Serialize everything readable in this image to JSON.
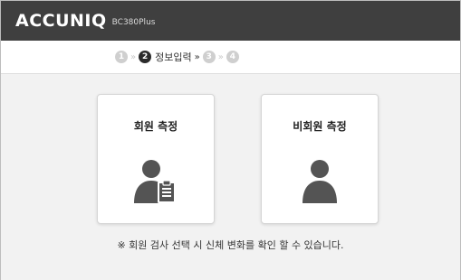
{
  "header": {
    "brand": "ACCUNIQ",
    "model": "BC380Plus"
  },
  "steps": {
    "items": [
      {
        "number": "1",
        "active": false
      },
      {
        "number": "2",
        "active": true,
        "label": "정보입력"
      },
      {
        "number": "3",
        "active": false
      },
      {
        "number": "4",
        "active": false
      }
    ],
    "separator": "»"
  },
  "cards": {
    "member": {
      "title": "회원 측정",
      "icon": "member-clipboard-icon"
    },
    "non_member": {
      "title": "비회원 측정",
      "icon": "person-icon"
    }
  },
  "note": "※ 회원 검사 선택 시 신체 변화를 확인 할 수 있습니다.",
  "colors": {
    "header_bg": "#3f3f3f",
    "active_step": "#2b2b2b",
    "inactive_step": "#cfcfcf",
    "icon": "#545454",
    "panel_bg": "#f2f2f2"
  }
}
